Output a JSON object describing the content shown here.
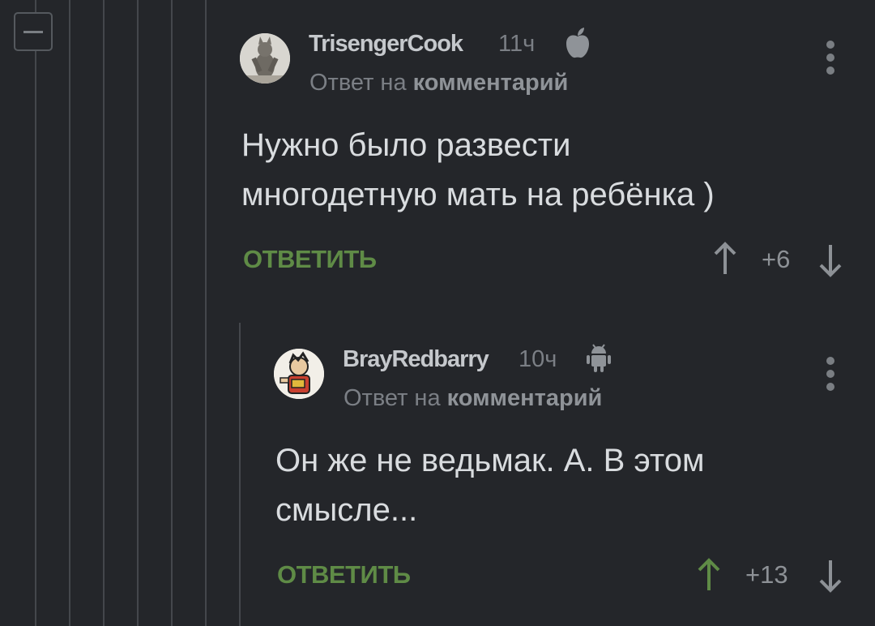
{
  "comments": [
    {
      "username": "TrisengerCook",
      "time": "11ч",
      "platform_icon": "apple-icon",
      "reply_prefix": "Ответ на",
      "reply_target": "комментарий",
      "text_line1": "Нужно было развести",
      "text_line2": "многодетную мать на ребёнка )",
      "reply_label": "ОТВЕТИТЬ",
      "rating": "+6",
      "upvoted": false
    },
    {
      "username": "BrayRedbarry",
      "time": "10ч",
      "platform_icon": "android-icon",
      "reply_prefix": "Ответ на",
      "reply_target": "комментарий",
      "text_line1": "Он же не ведьмак. А. В этом",
      "text_line2": "смысле...",
      "reply_label": "ОТВЕТИТЬ",
      "rating": "+13",
      "upvoted": true
    }
  ],
  "colors": {
    "background": "#24262a",
    "accent_green": "#5f8b46",
    "thread_line": "#44474c"
  }
}
